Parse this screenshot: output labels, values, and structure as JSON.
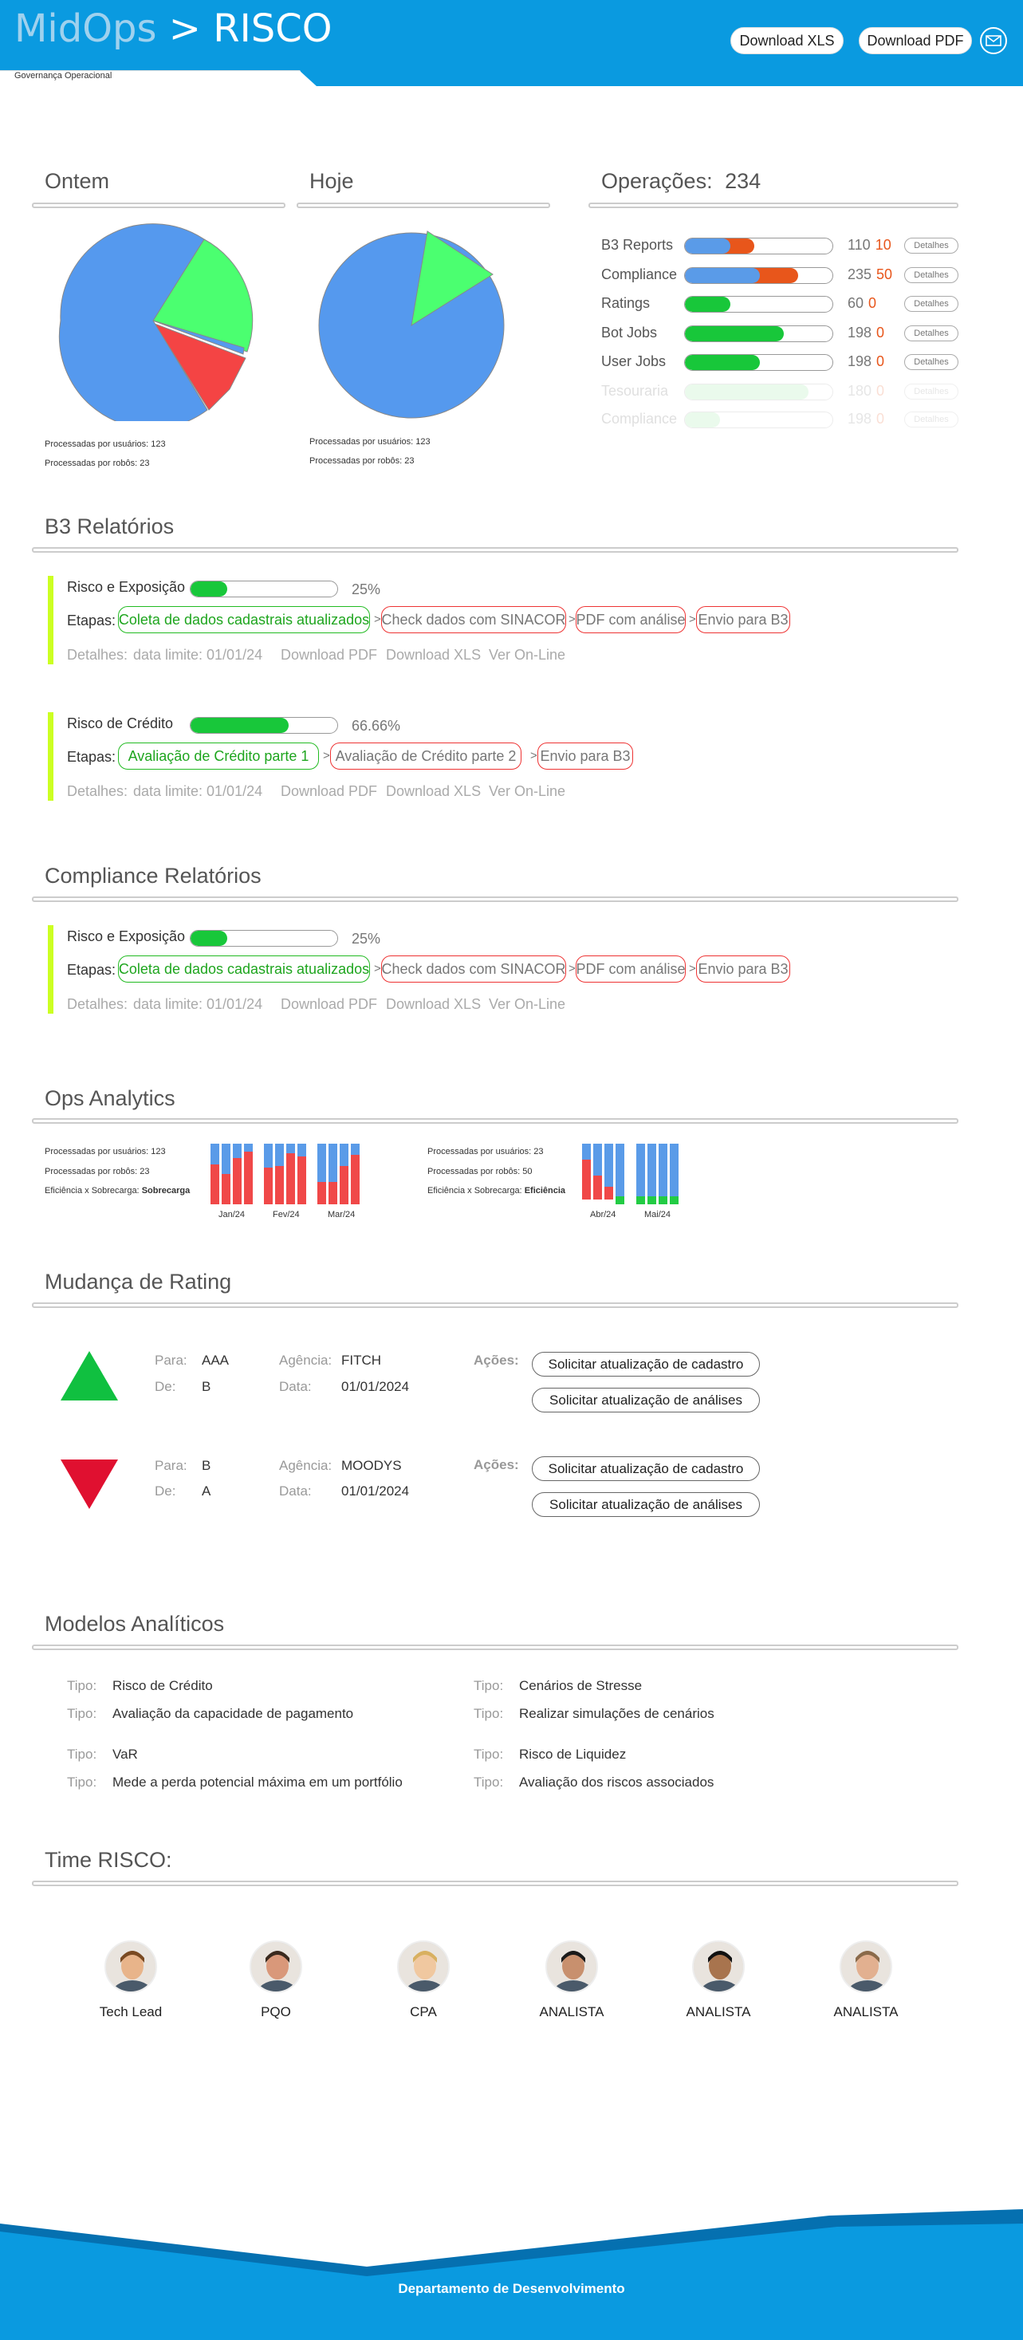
{
  "header": {
    "brand_mid": "MidOps",
    "brand_sep": ">",
    "brand_app": "RISCO",
    "subtitle": "Governança Operacional",
    "download_xls": "Download XLS",
    "download_pdf": "Download PDF",
    "colors": {
      "primary": "#0a9ae0",
      "dark": "#0570b0"
    }
  },
  "pies": {
    "ontem": {
      "title": "Ontem",
      "note_users": "Processadas por usuários: 123",
      "note_robots": "Processadas por robôs: 23"
    },
    "hoje": {
      "title": "Hoje",
      "note_users": "Processadas por usuários: 123",
      "note_robots": "Processadas por robôs: 23"
    }
  },
  "operations": {
    "title": "Operações:",
    "count": "234",
    "detail_label": "Detalhes",
    "rows": [
      {
        "label": "B3 Reports",
        "total": "110",
        "errors": "10",
        "blue": 0.31,
        "orange": 0.16,
        "green": 0
      },
      {
        "label": "Compliance",
        "total": "235",
        "errors": "50",
        "blue": 0.51,
        "orange": 0.26,
        "green": 0
      },
      {
        "label": "Ratings",
        "total": "60",
        "errors": "0",
        "blue": 0,
        "orange": 0,
        "green": 0.31
      },
      {
        "label": "Bot Jobs",
        "total": "198",
        "errors": "0",
        "blue": 0,
        "orange": 0,
        "green": 0.67
      },
      {
        "label": "User Jobs",
        "total": "198",
        "errors": "0",
        "blue": 0,
        "orange": 0,
        "green": 0.51
      },
      {
        "label": "Tesouraria",
        "total": "180",
        "errors": "0",
        "blue": 0,
        "orange": 0,
        "green": 0.84,
        "faded": true
      },
      {
        "label": "Compliance",
        "total": "198",
        "errors": "0",
        "blue": 0,
        "orange": 0,
        "green": 0.24,
        "faded": true
      }
    ]
  },
  "b3": {
    "title": "B3 Relatórios",
    "etapas_label": "Etapas:",
    "details_label": "Detalhes:",
    "reports": [
      {
        "name": "Risco e Exposição",
        "progress": 0.25,
        "pct": "25%",
        "steps": [
          "Coleta de dados cadastrais atualizados",
          "Check dados com SINACOR",
          "PDF com análise",
          "Envio para B3"
        ],
        "deadline": "data limite: 01/01/24",
        "pdf": "Download PDF",
        "xls": "Download XLS",
        "online": "Ver On-Line"
      },
      {
        "name": "Risco de Crédito",
        "progress": 0.6666,
        "pct": "66.66%",
        "steps": [
          "Avaliação de Crédito parte 1",
          "Avaliação de Crédito parte 2",
          "Envio para B3"
        ],
        "deadline": "data limite: 01/01/24",
        "pdf": "Download PDF",
        "xls": "Download XLS",
        "online": "Ver On-Line"
      }
    ]
  },
  "compliance": {
    "title": "Compliance Relatórios",
    "reports": [
      {
        "name": "Risco e Exposição",
        "progress": 0.25,
        "pct": "25%",
        "steps": [
          "Coleta de dados cadastrais atualizados",
          "Check dados com SINACOR",
          "PDF com análise",
          "Envio para B3"
        ],
        "deadline": "data limite: 01/01/24",
        "pdf": "Download PDF",
        "xls": "Download XLS",
        "online": "Ver On-Line"
      }
    ]
  },
  "analytics": {
    "title": "Ops Analytics",
    "left": {
      "users": "Processadas por usuários: 123",
      "robots": "Processadas por robôs: 23",
      "eff_label": "Eficiência x Sobrecarga:",
      "eff_value": "Sobrecarga",
      "months": [
        "Jan/24",
        "Fev/24",
        "Mar/24"
      ]
    },
    "right": {
      "users": "Processadas por usuários: 23",
      "robots": "Processadas por robôs: 50",
      "eff_label": "Eficiência x Sobrecarga:",
      "eff_value": "Eficiência",
      "months": [
        "Abr/24",
        "Mai/24"
      ]
    }
  },
  "rating": {
    "title": "Mudança de Rating",
    "lbl_para": "Para:",
    "lbl_de": "De:",
    "lbl_agencia": "Agência:",
    "lbl_data": "Data:",
    "lbl_acoes": "Ações:",
    "btn_cadastro": "Solicitar atualização de cadastro",
    "btn_analises": "Solicitar atualização de análises",
    "items": [
      {
        "para": "AAA",
        "de": "B",
        "agencia": "FITCH",
        "data": "01/01/2024",
        "direction": "up",
        "color": "#10c040"
      },
      {
        "para": "B",
        "de": "A",
        "agencia": "MOODYS",
        "data": "01/01/2024",
        "direction": "down",
        "color": "#e01030"
      }
    ]
  },
  "models": {
    "title": "Modelos Analíticos",
    "tipo_label": "Tipo:",
    "items": [
      {
        "name": "Risco de Crédito",
        "desc": "Avaliação da capacidade de pagamento"
      },
      {
        "name": "Cenários de Stresse",
        "desc": "Realizar simulações de cenários"
      },
      {
        "name": "VaR",
        "desc": "Mede a perda potencial máxima em um portfólio"
      },
      {
        "name": "Risco de Liquidez",
        "desc": "Avaliação dos riscos associados"
      }
    ]
  },
  "team": {
    "title": "Time RISCO:",
    "members": [
      {
        "role": "Tech Lead"
      },
      {
        "role": "PQO"
      },
      {
        "role": "CPA"
      },
      {
        "role": "ANALISTA"
      },
      {
        "role": "ANALISTA"
      },
      {
        "role": "ANALISTA"
      }
    ]
  },
  "footer": {
    "text": "Departamento de Desenvolvimento"
  }
}
